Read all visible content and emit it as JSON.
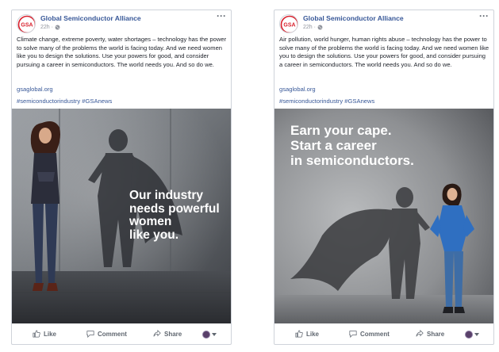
{
  "posts": [
    {
      "page_name": "Global Semiconductor Alliance",
      "logo_text": "GSA",
      "time": "22h ·",
      "more": "···",
      "text": "Climate change, extreme poverty, water shortages – technology has the power to solve many of the problems the world is facing today. And we need women like you to design the solutions. Use your powers for good, and consider pursuing a career in semiconductors. The world needs you. And so do we.",
      "link": "gsaglobal.org",
      "hashtags": "#semiconductorindustry #GSAnews",
      "image_text": [
        "Our industry",
        "needs powerful",
        "women",
        "like you."
      ],
      "actions": {
        "like": "Like",
        "comment": "Comment",
        "share": "Share"
      }
    },
    {
      "page_name": "Global Semiconductor Alliance",
      "logo_text": "GSA",
      "time": "22h ·",
      "more": "···",
      "text": "Air pollution, world hunger, human rights abuse – technology has the power to solve many of the problems the world is facing today. And we need women like you to design the solutions. Use your powers for good, and consider pursuing a career in semiconductors. The world needs you. And so do we.",
      "link": "gsaglobal.org",
      "hashtags": "#semiconductorindustry #GSAnews",
      "image_text": [
        "Earn your cape.",
        "Start a career",
        "in semiconductors."
      ],
      "actions": {
        "like": "Like",
        "comment": "Comment",
        "share": "Share"
      }
    }
  ],
  "colors": {
    "link": "#385898",
    "text": "#1d2129",
    "muted": "#90949c",
    "logo_red": "#d81e2a"
  },
  "icons": [
    "gsa-logo",
    "globe-icon",
    "more-icon",
    "like-icon",
    "comment-icon",
    "share-icon",
    "reaction-avatar-icon",
    "chevron-down-icon"
  ]
}
